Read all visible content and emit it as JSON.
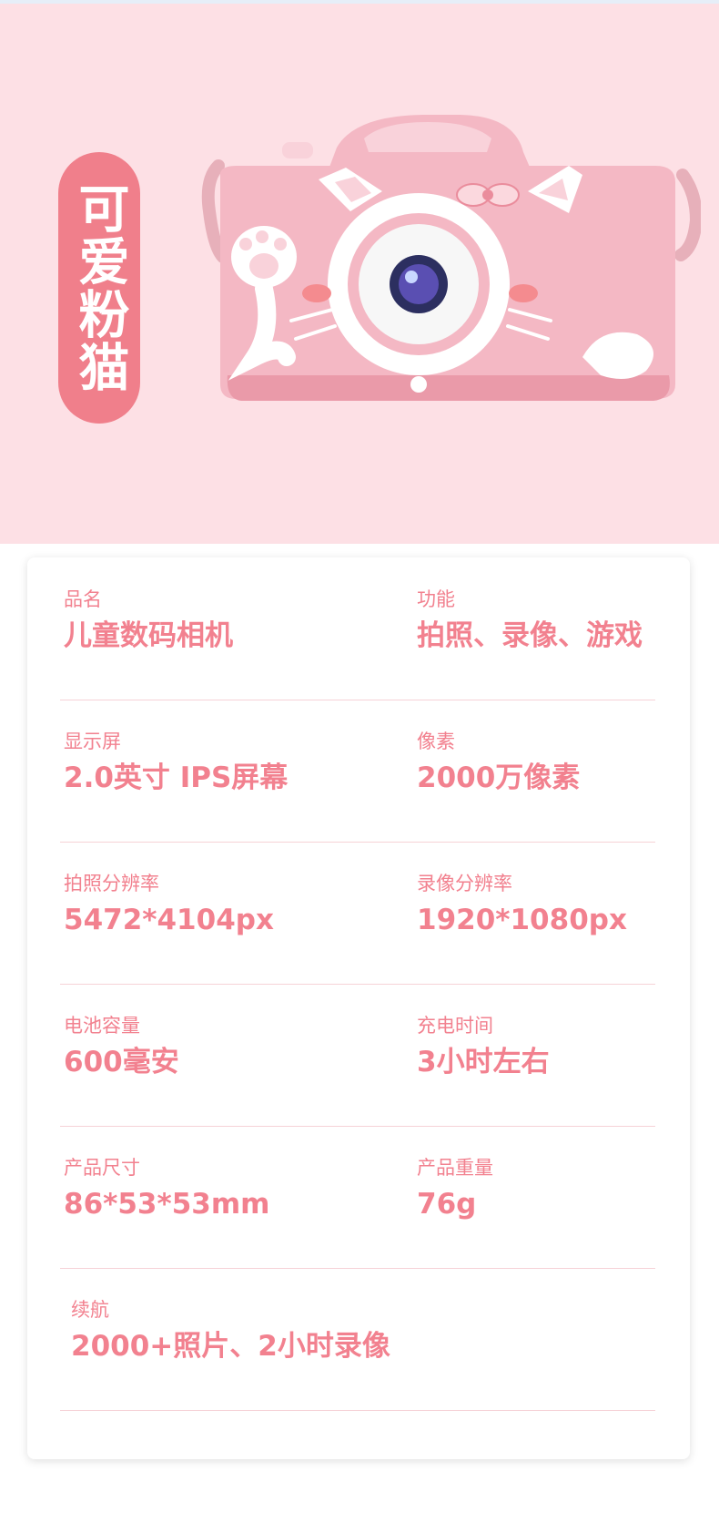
{
  "hero": {
    "badge_text": "可爱粉猫",
    "colors": {
      "background": "#fde0e5",
      "badge": "#f07f8b",
      "camera_body": "#f4b8c4"
    }
  },
  "specs": [
    {
      "left": {
        "label": "品名",
        "value": "儿童数码相机"
      },
      "right": {
        "label": "功能",
        "value": "拍照、录像、游戏"
      }
    },
    {
      "left": {
        "label": "显示屏",
        "value": "2.0英寸 IPS屏幕"
      },
      "right": {
        "label": "像素",
        "value": "2000万像素"
      }
    },
    {
      "left": {
        "label": "拍照分辨率",
        "value": "5472*4104px"
      },
      "right": {
        "label": "录像分辨率",
        "value": "1920*1080px"
      }
    },
    {
      "left": {
        "label": "电池容量",
        "value": "600毫安"
      },
      "right": {
        "label": "充电时间",
        "value": "3小时左右"
      }
    },
    {
      "left": {
        "label": "产品尺寸",
        "value": "86*53*53mm"
      },
      "right": {
        "label": "产品重量",
        "value": "76g"
      }
    },
    {
      "left": {
        "label": "续航",
        "value": "2000+照片、2小时录像"
      }
    }
  ],
  "colors": {
    "text": "#f2818f",
    "divider": "#f6d2d7"
  }
}
